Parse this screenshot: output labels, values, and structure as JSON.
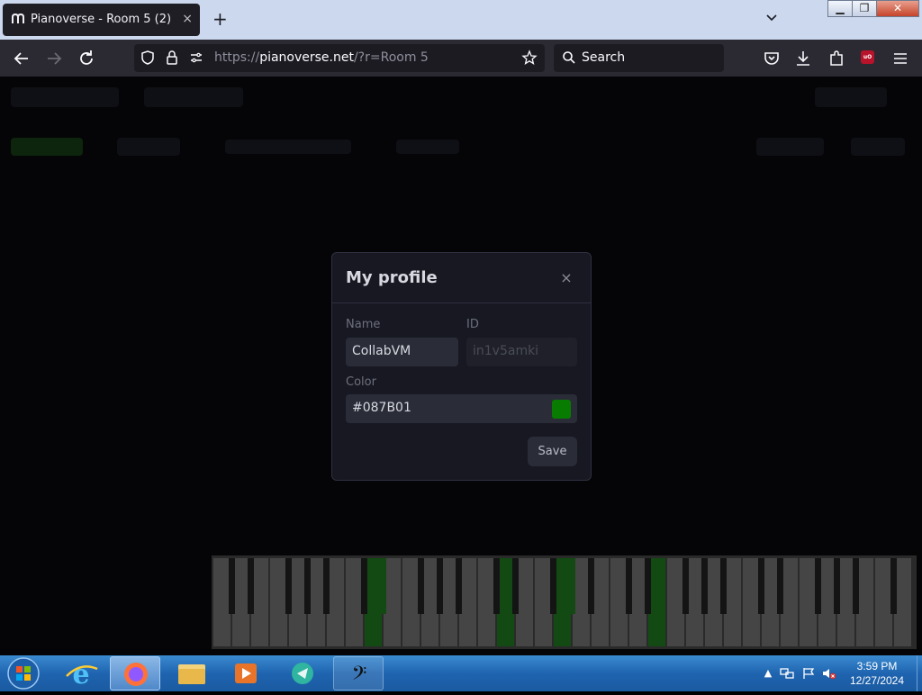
{
  "browser": {
    "tab_title": "Pianoverse - Room 5 (2)",
    "tab_close": "×",
    "new_tab": "+",
    "url_host": "pianoverse.net",
    "url_prefix": "https://",
    "url_suffix": "/?r=Room 5",
    "search_placeholder": "Search"
  },
  "window_controls": {
    "minimize": "▁",
    "maximize": "❐",
    "close": "✕"
  },
  "modal": {
    "title": "My profile",
    "close": "×",
    "name_label": "Name",
    "name_value": "CollabVM",
    "id_label": "ID",
    "id_value": "in1v5amki",
    "color_label": "Color",
    "color_value": "#087B01",
    "save_label": "Save"
  },
  "colors": {
    "profile_color": "#087B01",
    "accent_green": "#087B01"
  },
  "taskbar": {
    "apps": [
      "internet-explorer",
      "firefox",
      "file-explorer",
      "media-player",
      "collabvm-app",
      "bass-clef-app"
    ],
    "time": "3:59 PM",
    "date": "12/27/2024"
  }
}
